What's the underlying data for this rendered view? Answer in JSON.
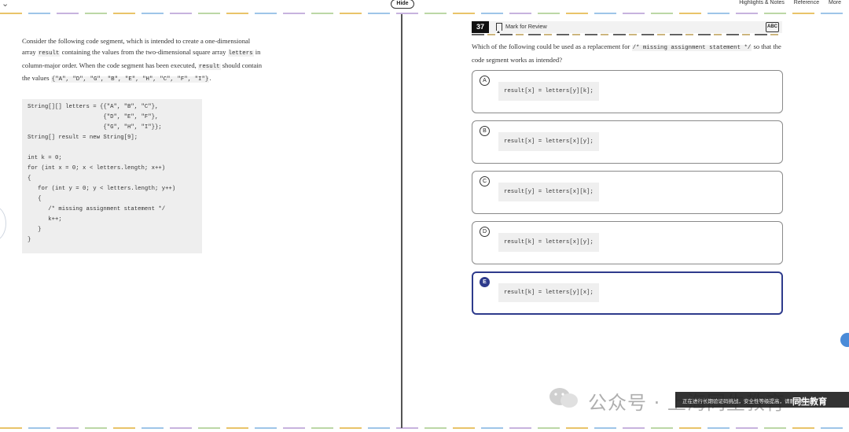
{
  "header": {
    "hide_label": "Hide",
    "links": [
      "Highlights & Notes",
      "Reference",
      "More"
    ]
  },
  "passage": {
    "line1": "Consider the following code segment, which is intended to create a one-dimensional",
    "line2_a": "array ",
    "line2_code1": "result",
    "line2_b": " containing the values from the two-dimensional square array ",
    "line2_code2": "letters",
    "line2_c": " in",
    "line3_a": "column-major order. When the code segment has been executed, ",
    "line3_code": "result",
    "line3_b": " should contain",
    "line4_a": "the values ",
    "line4_code": "{\"A\", \"D\", \"G\", \"B\", \"E\", \"H\", \"C\", \"F\", \"I\"}",
    "line4_b": "."
  },
  "code_lines": [
    "String[][] letters = {{\"A\", \"B\", \"C\"},",
    "                      {\"D\", \"E\", \"F\"},",
    "                      {\"G\", \"H\", \"I\"}};",
    "String[] result = new String[9];",
    "",
    "int k = 0;",
    "for (int x = 0; x < letters.length; x++)",
    "{",
    "   for (int y = 0; y < letters.length; y++)",
    "   {",
    "      /* missing assignment statement */",
    "      k++;",
    "   }",
    "}"
  ],
  "question": {
    "number": "37",
    "mark_label": "Mark for Review",
    "abc_label": "ABC",
    "text_a": "Which of the following could be used as a replacement for ",
    "text_code": "/* missing assignment statement */",
    "text_b": " so that the code segment works as intended?"
  },
  "options": [
    {
      "letter": "A",
      "code": "result[x] = letters[y][k];",
      "selected": false
    },
    {
      "letter": "B",
      "code": "result[x] = letters[x][y];",
      "selected": false
    },
    {
      "letter": "C",
      "code": "result[y] = letters[x][k];",
      "selected": false
    },
    {
      "letter": "D",
      "code": "result[k] = letters[x][y];",
      "selected": false
    },
    {
      "letter": "E",
      "code": "result[k] = letters[y][x];",
      "selected": true
    }
  ],
  "watermark": {
    "text": "公众号 · 上海同生教育",
    "toast": "正在进行长期验证码挑战，安全性等级提高，请耐心等待",
    "brand": "同生教育"
  }
}
